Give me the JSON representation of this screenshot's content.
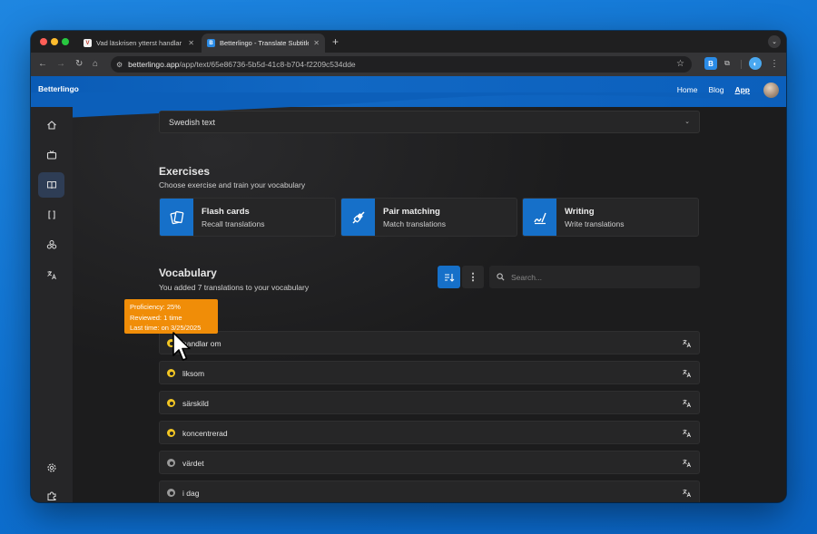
{
  "browser": {
    "tabs": [
      {
        "title": "Vad läskrisen ytterst handlar om",
        "favicon": "V",
        "active": false
      },
      {
        "title": "Betterlingo - Translate Subtitles",
        "favicon": "B",
        "active": true
      }
    ],
    "url_host": "betterlingo.app",
    "url_path": "/app/text/65e86736-5b5d-41c8-b704-f2209c534dde",
    "extension_label": "B"
  },
  "app": {
    "brand": "Betterlingo",
    "nav": {
      "home": "Home",
      "blog": "Blog",
      "app": "App"
    },
    "sidebar_icons": [
      "home-icon",
      "tv-icon",
      "book-icon",
      "brackets-icon",
      "group-icon",
      "translate-icon",
      "settings-icon",
      "puzzle-icon"
    ]
  },
  "text_select": {
    "value": "Swedish text"
  },
  "exercises": {
    "title": "Exercises",
    "subtitle": "Choose exercise and train your vocabulary",
    "cards": [
      {
        "title": "Flash cards",
        "subtitle": "Recall translations",
        "icon": "flash-cards-icon"
      },
      {
        "title": "Pair matching",
        "subtitle": "Match translations",
        "icon": "pair-matching-icon"
      },
      {
        "title": "Writing",
        "subtitle": "Write translations",
        "icon": "writing-icon"
      }
    ]
  },
  "vocabulary": {
    "title": "Vocabulary",
    "subtitle": "You added 7 translations to your vocabulary",
    "search_placeholder": "Search...",
    "items": [
      {
        "word": "handlar om",
        "level_color": "#f3c623"
      },
      {
        "word": "liksom",
        "level_color": "#f3c623"
      },
      {
        "word": "särskild",
        "level_color": "#f3c623"
      },
      {
        "word": "koncentrerad",
        "level_color": "#f3c623"
      },
      {
        "word": "värdet",
        "level_color": "#9a9a9a"
      },
      {
        "word": "i dag",
        "level_color": "#9a9a9a"
      }
    ]
  },
  "tooltip": {
    "proficiency": "Proficiency: 25%",
    "reviewed": "Reviewed: 1 time",
    "last_time": "Last time: on 3/25/2025"
  },
  "colors": {
    "accent": "#1670c9",
    "tooltip": "#f08d08",
    "level_learning": "#f3c623",
    "level_new": "#9a9a9a"
  }
}
